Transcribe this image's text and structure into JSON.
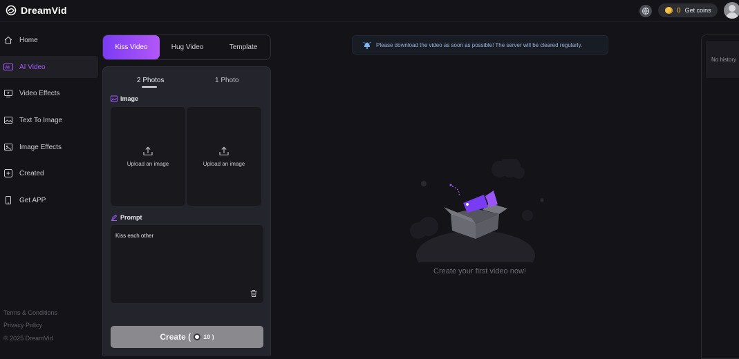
{
  "app": {
    "name": "DreamVid"
  },
  "header": {
    "coin_count": "0",
    "get_coins_label": "Get coins"
  },
  "sidebar": {
    "items": [
      {
        "label": "Home",
        "icon": "home-icon"
      },
      {
        "label": "AI Video",
        "icon": "ai-badge-icon",
        "active": true
      },
      {
        "label": "Video Effects",
        "icon": "video-effects-icon"
      },
      {
        "label": "Text To Image",
        "icon": "image-icon"
      },
      {
        "label": "Image Effects",
        "icon": "image-effects-icon"
      },
      {
        "label": "Created",
        "icon": "plus-square-icon"
      },
      {
        "label": "Get APP",
        "icon": "phone-icon"
      }
    ],
    "footer": {
      "terms": "Terms & Conditions",
      "privacy": "Privacy Policy",
      "copyright": "© 2025 DreamVid"
    }
  },
  "mode_tabs": {
    "items": [
      "Kiss Video",
      "Hug Video",
      "Template"
    ],
    "active": "Kiss Video"
  },
  "panel": {
    "subtabs": [
      "2 Photos",
      "1 Photo"
    ],
    "image_label": "Image",
    "upload_left": "Upload an image",
    "upload_right": "Upload an image",
    "prompt_label": "Prompt",
    "prompt_value": "Kiss each other",
    "create_label": "Create (",
    "create_cost": "10 )"
  },
  "notice": {
    "text": "Please download the video as soon as possible! The server will be cleared regularly."
  },
  "empty_state": {
    "text": "Create your first video now!"
  },
  "history": {
    "empty_text": "No history"
  },
  "colors": {
    "accent": "#a35cff",
    "tab_gradient_start": "#7a3cf3",
    "tab_gradient_end": "#b357f8",
    "coin": "#f2c14a"
  }
}
